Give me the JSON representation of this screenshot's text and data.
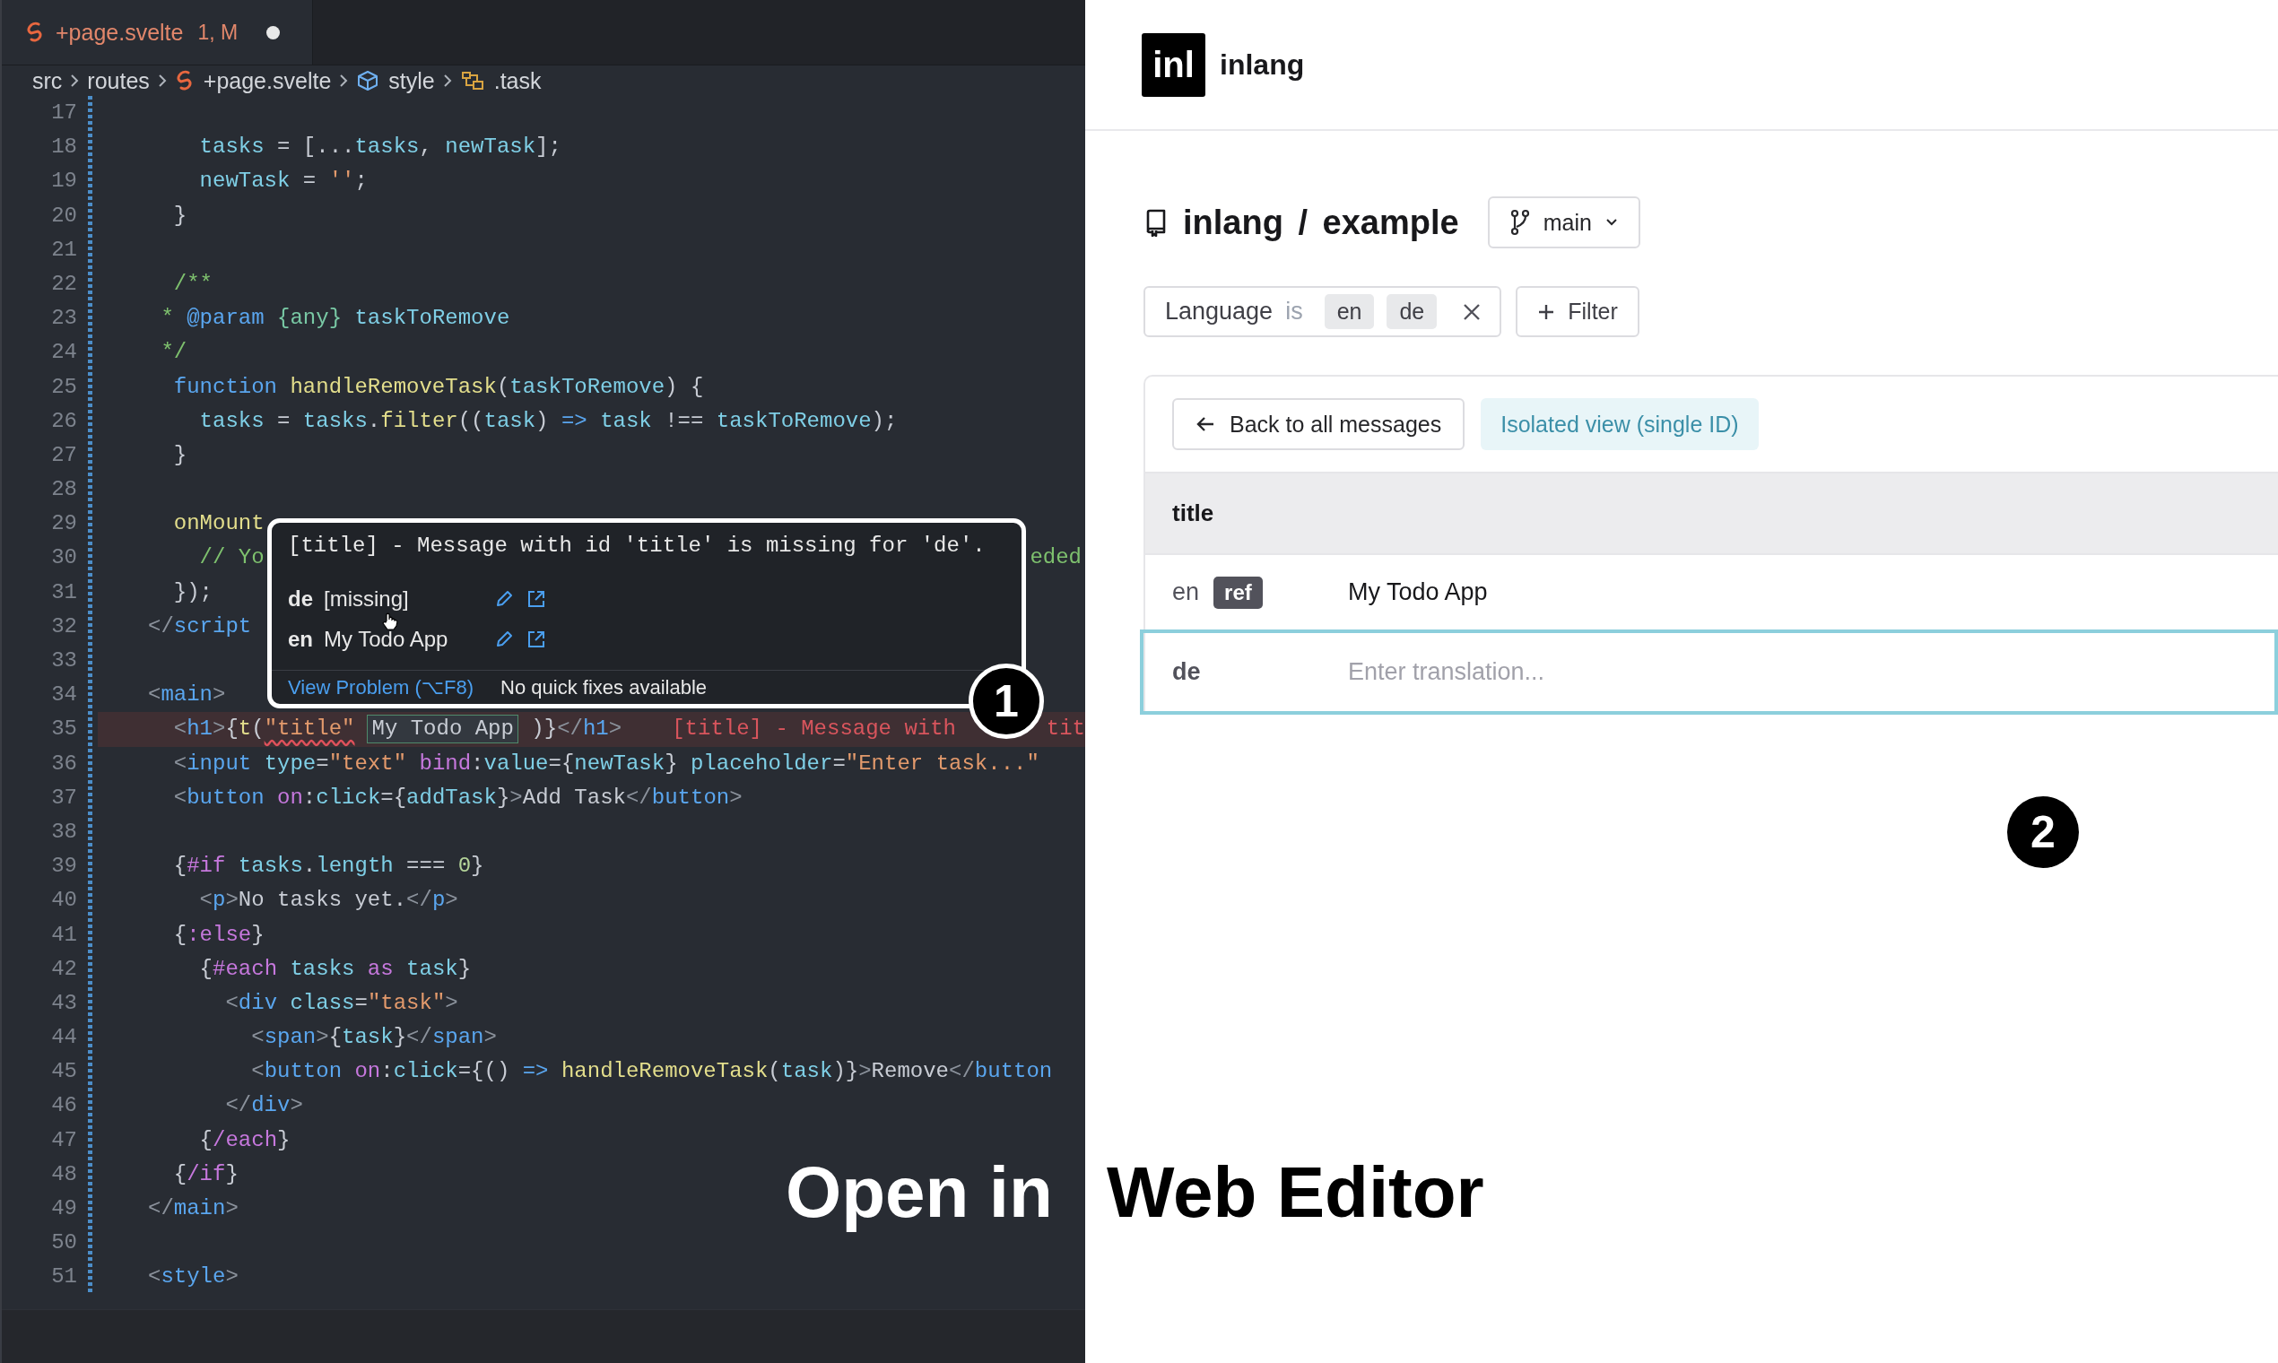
{
  "editor": {
    "tab": {
      "filename": "+page.svelte",
      "status": "1, M",
      "unsaved": true
    },
    "breadcrumb": [
      {
        "kind": "folder",
        "label": "src"
      },
      {
        "kind": "folder",
        "label": "routes"
      },
      {
        "kind": "file",
        "label": "+page.svelte"
      },
      {
        "kind": "element",
        "label": "style"
      },
      {
        "kind": "selector",
        "label": ".task"
      }
    ],
    "lines": [
      {
        "number": "17",
        "highlighted": false
      },
      {
        "number": "18",
        "highlighted": false,
        "tokens": [
          {
            "text": "    tasks",
            "kind": "var"
          },
          {
            "text": " = [...",
            "kind": "plain"
          },
          {
            "text": "tasks",
            "kind": "var"
          },
          {
            "text": ", ",
            "kind": "plain"
          },
          {
            "text": "newTask",
            "kind": "var"
          },
          {
            "text": "];",
            "kind": "plain"
          }
        ]
      },
      {
        "number": "19",
        "highlighted": false,
        "tokens": [
          {
            "text": "    newTask",
            "kind": "var"
          },
          {
            "text": " = ",
            "kind": "plain"
          },
          {
            "text": "''",
            "kind": "string"
          },
          {
            "text": ";",
            "kind": "plain"
          }
        ]
      },
      {
        "number": "20",
        "highlighted": false,
        "tokens": [
          {
            "text": "  }",
            "kind": "plain"
          }
        ]
      },
      {
        "number": "21",
        "highlighted": false
      },
      {
        "number": "22",
        "highlighted": false,
        "tokens": [
          {
            "text": "  /**",
            "kind": "comment"
          }
        ]
      },
      {
        "number": "23",
        "highlighted": false,
        "tokens": [
          {
            "text": " * ",
            "kind": "comment"
          },
          {
            "text": "@param",
            "kind": "keyword"
          },
          {
            "text": " {any}",
            "kind": "type"
          },
          {
            "text": " taskToRemove",
            "kind": "var"
          }
        ]
      },
      {
        "number": "24",
        "highlighted": false,
        "tokens": [
          {
            "text": " */",
            "kind": "comment"
          }
        ]
      },
      {
        "number": "25",
        "highlighted": false,
        "tokens": [
          {
            "text": "  function",
            "kind": "keyword"
          },
          {
            "text": " handleRemoveTask",
            "kind": "func"
          },
          {
            "text": "(",
            "kind": "plain"
          },
          {
            "text": "taskToRemove",
            "kind": "var"
          },
          {
            "text": ") {",
            "kind": "plain"
          }
        ]
      },
      {
        "number": "26",
        "highlighted": false,
        "tokens": [
          {
            "text": "    tasks",
            "kind": "var"
          },
          {
            "text": " = ",
            "kind": "plain"
          },
          {
            "text": "tasks",
            "kind": "var"
          },
          {
            "text": ".",
            "kind": "plain"
          },
          {
            "text": "filter",
            "kind": "func"
          },
          {
            "text": "((",
            "kind": "plain"
          },
          {
            "text": "task",
            "kind": "var"
          },
          {
            "text": ") ",
            "kind": "plain"
          },
          {
            "text": "=>",
            "kind": "keyword"
          },
          {
            "text": " task",
            "kind": "var"
          },
          {
            "text": " !== ",
            "kind": "plain"
          },
          {
            "text": "taskToRemove",
            "kind": "var"
          },
          {
            "text": ");",
            "kind": "plain"
          }
        ]
      },
      {
        "number": "27",
        "highlighted": false,
        "tokens": [
          {
            "text": "  }",
            "kind": "plain"
          }
        ]
      },
      {
        "number": "28",
        "highlighted": false
      },
      {
        "number": "29",
        "highlighted": false,
        "tokens": [
          {
            "text": "  onMount",
            "kind": "func"
          }
        ]
      },
      {
        "number": "30",
        "highlighted": false,
        "tokens": [
          {
            "text": "    // Yo",
            "kind": "comment"
          },
          {
            "text": "eded",
            "kind": "tail-comment"
          }
        ]
      },
      {
        "number": "31",
        "highlighted": false,
        "tokens": [
          {
            "text": "  });",
            "kind": "plain"
          }
        ]
      },
      {
        "number": "32",
        "highlighted": false,
        "tokens": [
          {
            "text": "</",
            "kind": "punct"
          },
          {
            "text": "script",
            "kind": "tag"
          }
        ]
      },
      {
        "number": "33",
        "highlighted": false
      },
      {
        "number": "34",
        "highlighted": false,
        "tokens": [
          {
            "text": "<",
            "kind": "punct"
          },
          {
            "text": "main",
            "kind": "tag"
          },
          {
            "text": ">",
            "kind": "punct"
          }
        ]
      },
      {
        "number": "35",
        "highlighted": true,
        "tokens": [
          {
            "text": "  <",
            "kind": "punct"
          },
          {
            "text": "h1",
            "kind": "tag"
          },
          {
            "text": ">",
            "kind": "punct"
          },
          {
            "text": "{",
            "kind": "plain"
          },
          {
            "text": "t",
            "kind": "func"
          },
          {
            "text": "(",
            "kind": "plain"
          },
          {
            "text": "\"title\"",
            "kind": "error-string"
          },
          {
            "text": "My Todo App",
            "kind": "hint"
          },
          {
            "text": " )}",
            "kind": "plain"
          },
          {
            "text": "</",
            "kind": "punct"
          },
          {
            "text": "h1",
            "kind": "tag"
          },
          {
            "text": ">",
            "kind": "punct"
          },
          {
            "text": "[title] - Message with",
            "kind": "diagnostic"
          },
          {
            "text": "tit",
            "kind": "tail-diagnostic"
          }
        ]
      },
      {
        "number": "36",
        "highlighted": false,
        "tokens": [
          {
            "text": "  <",
            "kind": "punct"
          },
          {
            "text": "input",
            "kind": "tag"
          },
          {
            "text": " type",
            "kind": "attr"
          },
          {
            "text": "=",
            "kind": "plain"
          },
          {
            "text": "\"text\"",
            "kind": "string"
          },
          {
            "text": " bind",
            "kind": "directive"
          },
          {
            "text": ":",
            "kind": "plain"
          },
          {
            "text": "value",
            "kind": "attr"
          },
          {
            "text": "={",
            "kind": "plain"
          },
          {
            "text": "newTask",
            "kind": "var"
          },
          {
            "text": "} ",
            "kind": "plain"
          },
          {
            "text": "placeholder",
            "kind": "attr"
          },
          {
            "text": "=",
            "kind": "plain"
          },
          {
            "text": "\"Enter task...\"",
            "kind": "string"
          }
        ]
      },
      {
        "number": "37",
        "highlighted": false,
        "tokens": [
          {
            "text": "  <",
            "kind": "punct"
          },
          {
            "text": "button",
            "kind": "tag"
          },
          {
            "text": " on",
            "kind": "directive"
          },
          {
            "text": ":",
            "kind": "plain"
          },
          {
            "text": "click",
            "kind": "attr"
          },
          {
            "text": "={",
            "kind": "plain"
          },
          {
            "text": "addTask",
            "kind": "var"
          },
          {
            "text": "}",
            "kind": "plain"
          },
          {
            "text": ">",
            "kind": "punct"
          },
          {
            "text": "Add Task",
            "kind": "plain"
          },
          {
            "text": "</",
            "kind": "punct"
          },
          {
            "text": "button",
            "kind": "tag"
          },
          {
            "text": ">",
            "kind": "punct"
          }
        ]
      },
      {
        "number": "38",
        "highlighted": false
      },
      {
        "number": "39",
        "highlighted": false,
        "tokens": [
          {
            "text": "  {",
            "kind": "plain"
          },
          {
            "text": "#if",
            "kind": "control"
          },
          {
            "text": " tasks",
            "kind": "var"
          },
          {
            "text": ".",
            "kind": "plain"
          },
          {
            "text": "length",
            "kind": "var"
          },
          {
            "text": " === ",
            "kind": "plain"
          },
          {
            "text": "0",
            "kind": "number"
          },
          {
            "text": "}",
            "kind": "plain"
          }
        ]
      },
      {
        "number": "40",
        "highlighted": false,
        "tokens": [
          {
            "text": "    <",
            "kind": "punct"
          },
          {
            "text": "p",
            "kind": "tag"
          },
          {
            "text": ">",
            "kind": "punct"
          },
          {
            "text": "No tasks yet.",
            "kind": "plain"
          },
          {
            "text": "</",
            "kind": "punct"
          },
          {
            "text": "p",
            "kind": "tag"
          },
          {
            "text": ">",
            "kind": "punct"
          }
        ]
      },
      {
        "number": "41",
        "highlighted": false,
        "tokens": [
          {
            "text": "  {",
            "kind": "plain"
          },
          {
            "text": ":else",
            "kind": "control"
          },
          {
            "text": "}",
            "kind": "plain"
          }
        ]
      },
      {
        "number": "42",
        "highlighted": false,
        "tokens": [
          {
            "text": "    {",
            "kind": "plain"
          },
          {
            "text": "#each",
            "kind": "control"
          },
          {
            "text": " tasks",
            "kind": "var"
          },
          {
            "text": " as",
            "kind": "control"
          },
          {
            "text": " task",
            "kind": "var"
          },
          {
            "text": "}",
            "kind": "plain"
          }
        ]
      },
      {
        "number": "43",
        "highlighted": false,
        "tokens": [
          {
            "text": "      <",
            "kind": "punct"
          },
          {
            "text": "div",
            "kind": "tag"
          },
          {
            "text": " class",
            "kind": "attr"
          },
          {
            "text": "=",
            "kind": "plain"
          },
          {
            "text": "\"task\"",
            "kind": "string"
          },
          {
            "text": ">",
            "kind": "punct"
          }
        ]
      },
      {
        "number": "44",
        "highlighted": false,
        "tokens": [
          {
            "text": "        <",
            "kind": "punct"
          },
          {
            "text": "span",
            "kind": "tag"
          },
          {
            "text": ">",
            "kind": "punct"
          },
          {
            "text": "{",
            "kind": "plain"
          },
          {
            "text": "task",
            "kind": "var"
          },
          {
            "text": "}",
            "kind": "plain"
          },
          {
            "text": "</",
            "kind": "punct"
          },
          {
            "text": "span",
            "kind": "tag"
          },
          {
            "text": ">",
            "kind": "punct"
          }
        ]
      },
      {
        "number": "45",
        "highlighted": false,
        "tokens": [
          {
            "text": "        <",
            "kind": "punct"
          },
          {
            "text": "button",
            "kind": "tag"
          },
          {
            "text": " on",
            "kind": "directive"
          },
          {
            "text": ":",
            "kind": "plain"
          },
          {
            "text": "click",
            "kind": "attr"
          },
          {
            "text": "={() ",
            "kind": "plain"
          },
          {
            "text": "=>",
            "kind": "keyword"
          },
          {
            "text": " handleRemoveTask",
            "kind": "func"
          },
          {
            "text": "(",
            "kind": "plain"
          },
          {
            "text": "task",
            "kind": "var"
          },
          {
            "text": ")}",
            "kind": "plain"
          },
          {
            "text": ">",
            "kind": "punct"
          },
          {
            "text": "Remove",
            "kind": "plain"
          },
          {
            "text": "</",
            "kind": "punct"
          },
          {
            "text": "button",
            "kind": "tag"
          }
        ]
      },
      {
        "number": "46",
        "highlighted": false,
        "tokens": [
          {
            "text": "      </",
            "kind": "punct"
          },
          {
            "text": "div",
            "kind": "tag"
          },
          {
            "text": ">",
            "kind": "punct"
          }
        ]
      },
      {
        "number": "47",
        "highlighted": false,
        "tokens": [
          {
            "text": "    {",
            "kind": "plain"
          },
          {
            "text": "/each",
            "kind": "control"
          },
          {
            "text": "}",
            "kind": "plain"
          }
        ]
      },
      {
        "number": "48",
        "highlighted": false,
        "tokens": [
          {
            "text": "  {",
            "kind": "plain"
          },
          {
            "text": "/if",
            "kind": "control"
          },
          {
            "text": "}",
            "kind": "plain"
          }
        ]
      },
      {
        "number": "49",
        "highlighted": false,
        "tokens": [
          {
            "text": "</",
            "kind": "punct"
          },
          {
            "text": "main",
            "kind": "tag"
          },
          {
            "text": ">",
            "kind": "punct"
          }
        ]
      },
      {
        "number": "50",
        "highlighted": false
      },
      {
        "number": "51",
        "highlighted": false,
        "tokens": [
          {
            "text": "<",
            "kind": "punct"
          },
          {
            "text": "style",
            "kind": "tag"
          },
          {
            "text": ">",
            "kind": "punct"
          }
        ]
      }
    ],
    "hover": {
      "message": "[title] - Message with id 'title' is missing for 'de'.",
      "translations": [
        {
          "language": "de",
          "text": "[missing]"
        },
        {
          "language": "en",
          "text": "My Todo App"
        }
      ],
      "action": "View Problem (⌥F8)",
      "status": "No quick fixes available"
    }
  },
  "web_editor": {
    "logo": "inl",
    "brand": "inlang",
    "repository": "inlang / example",
    "branch": "main",
    "filters": [
      {
        "field": "Language",
        "operator": "is",
        "values": [
          "en",
          "de"
        ]
      }
    ],
    "add_filter": "Filter",
    "back_button": "Back to all messages",
    "view_label": "Isolated view (single ID)",
    "message_id": "title",
    "variants": [
      {
        "language": "en",
        "tag": "ref",
        "text": "My Todo App",
        "focused": false
      },
      {
        "language": "de",
        "placeholder": "Enter translation...",
        "focused": true
      }
    ]
  },
  "callouts": [
    {
      "number": "1"
    },
    {
      "number": "2"
    }
  ],
  "headline": [
    "Open in",
    "Web Editor"
  ]
}
